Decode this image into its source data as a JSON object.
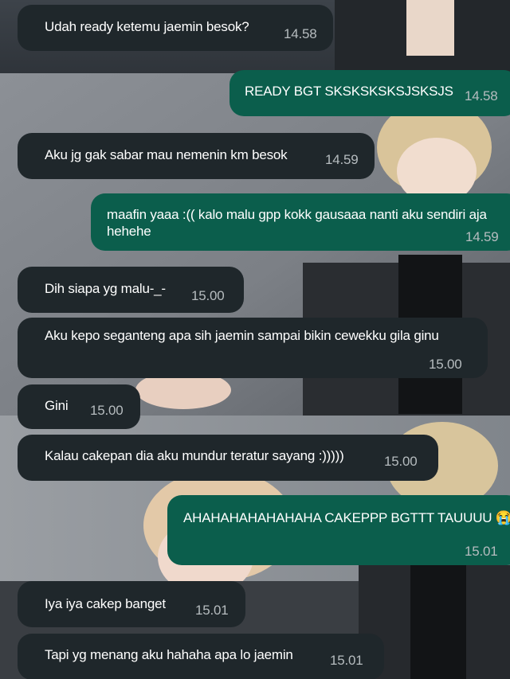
{
  "chat": {
    "background_colors": {
      "panel_dark": "#3a3f46",
      "panel_light": "#8a8e94",
      "incoming_bubble": "#1f272b",
      "outgoing_bubble": "#0b5e4c",
      "timestamp": "#b6bcbf"
    },
    "messages": [
      {
        "direction": "in",
        "text": "Udah ready ketemu jaemin besok?",
        "time": "14.58"
      },
      {
        "direction": "out",
        "text": "READY BGT SKSKSKSKSJSKSJS",
        "time": "14.58"
      },
      {
        "direction": "in",
        "text": "Aku jg gak sabar mau nemenin km besok",
        "time": "14.59"
      },
      {
        "direction": "out",
        "text": "maafin yaaa :(( kalo malu gpp kokk gausaaa nanti aku sendiri aja\nhehehe",
        "time": "14.59"
      },
      {
        "direction": "in",
        "text": "Dih siapa yg malu-_-",
        "time": "15.00"
      },
      {
        "direction": "in",
        "text": "Aku kepo seganteng apa sih jaemin sampai bikin cewekku gila ginu",
        "time": "15.00"
      },
      {
        "direction": "in",
        "text": "Gini",
        "time": "15.00"
      },
      {
        "direction": "in",
        "text": "Kalau cakepan dia aku mundur teratur sayang :)))))",
        "time": "15.00"
      },
      {
        "direction": "out",
        "text": "AHAHAHAHAHAHAHA CAKEPPP BGTTT TAUUUU 😭",
        "time": "15.01"
      },
      {
        "direction": "in",
        "text": "Iya iya cakep banget",
        "time": "15.01"
      },
      {
        "direction": "in",
        "text": "Tapi yg menang aku hahaha apa lo jaemin",
        "time": "15.01"
      }
    ]
  }
}
